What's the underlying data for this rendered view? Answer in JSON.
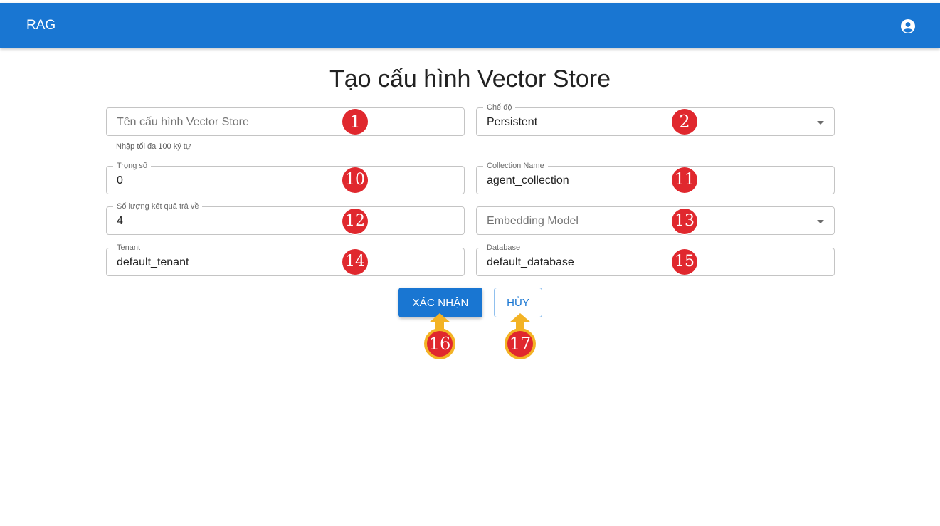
{
  "header": {
    "brand": "RAG",
    "account_icon": "account-circle-icon"
  },
  "form": {
    "title": "Tạo cấu hình Vector Store",
    "name_field": {
      "placeholder": "Tên cấu hình Vector Store",
      "helper": "Nhập tối đa 100 ký tự"
    },
    "mode_field": {
      "label": "Chế độ",
      "value": "Persistent"
    },
    "weight_field": {
      "label": "Trọng số",
      "value": "0"
    },
    "collection_field": {
      "label": "Collection Name",
      "value": "agent_collection"
    },
    "result_count_field": {
      "label": "Số lượng kết quả trả về",
      "value": "4"
    },
    "embedding_field": {
      "placeholder": "Embedding Model"
    },
    "tenant_field": {
      "label": "Tenant",
      "value": "default_tenant"
    },
    "database_field": {
      "label": "Database",
      "value": "default_database"
    },
    "confirm_button": "XÁC NHẬN",
    "cancel_button": "HỦY"
  },
  "annotations": {
    "badge_1": "1",
    "badge_2": "2",
    "badge_10": "10",
    "badge_11": "11",
    "badge_12": "12",
    "badge_13": "13",
    "badge_14": "14",
    "badge_15": "15",
    "badge_16": "16",
    "badge_17": "17",
    "badge_color": "#e0282e",
    "arrow_color": "#f3b325"
  }
}
